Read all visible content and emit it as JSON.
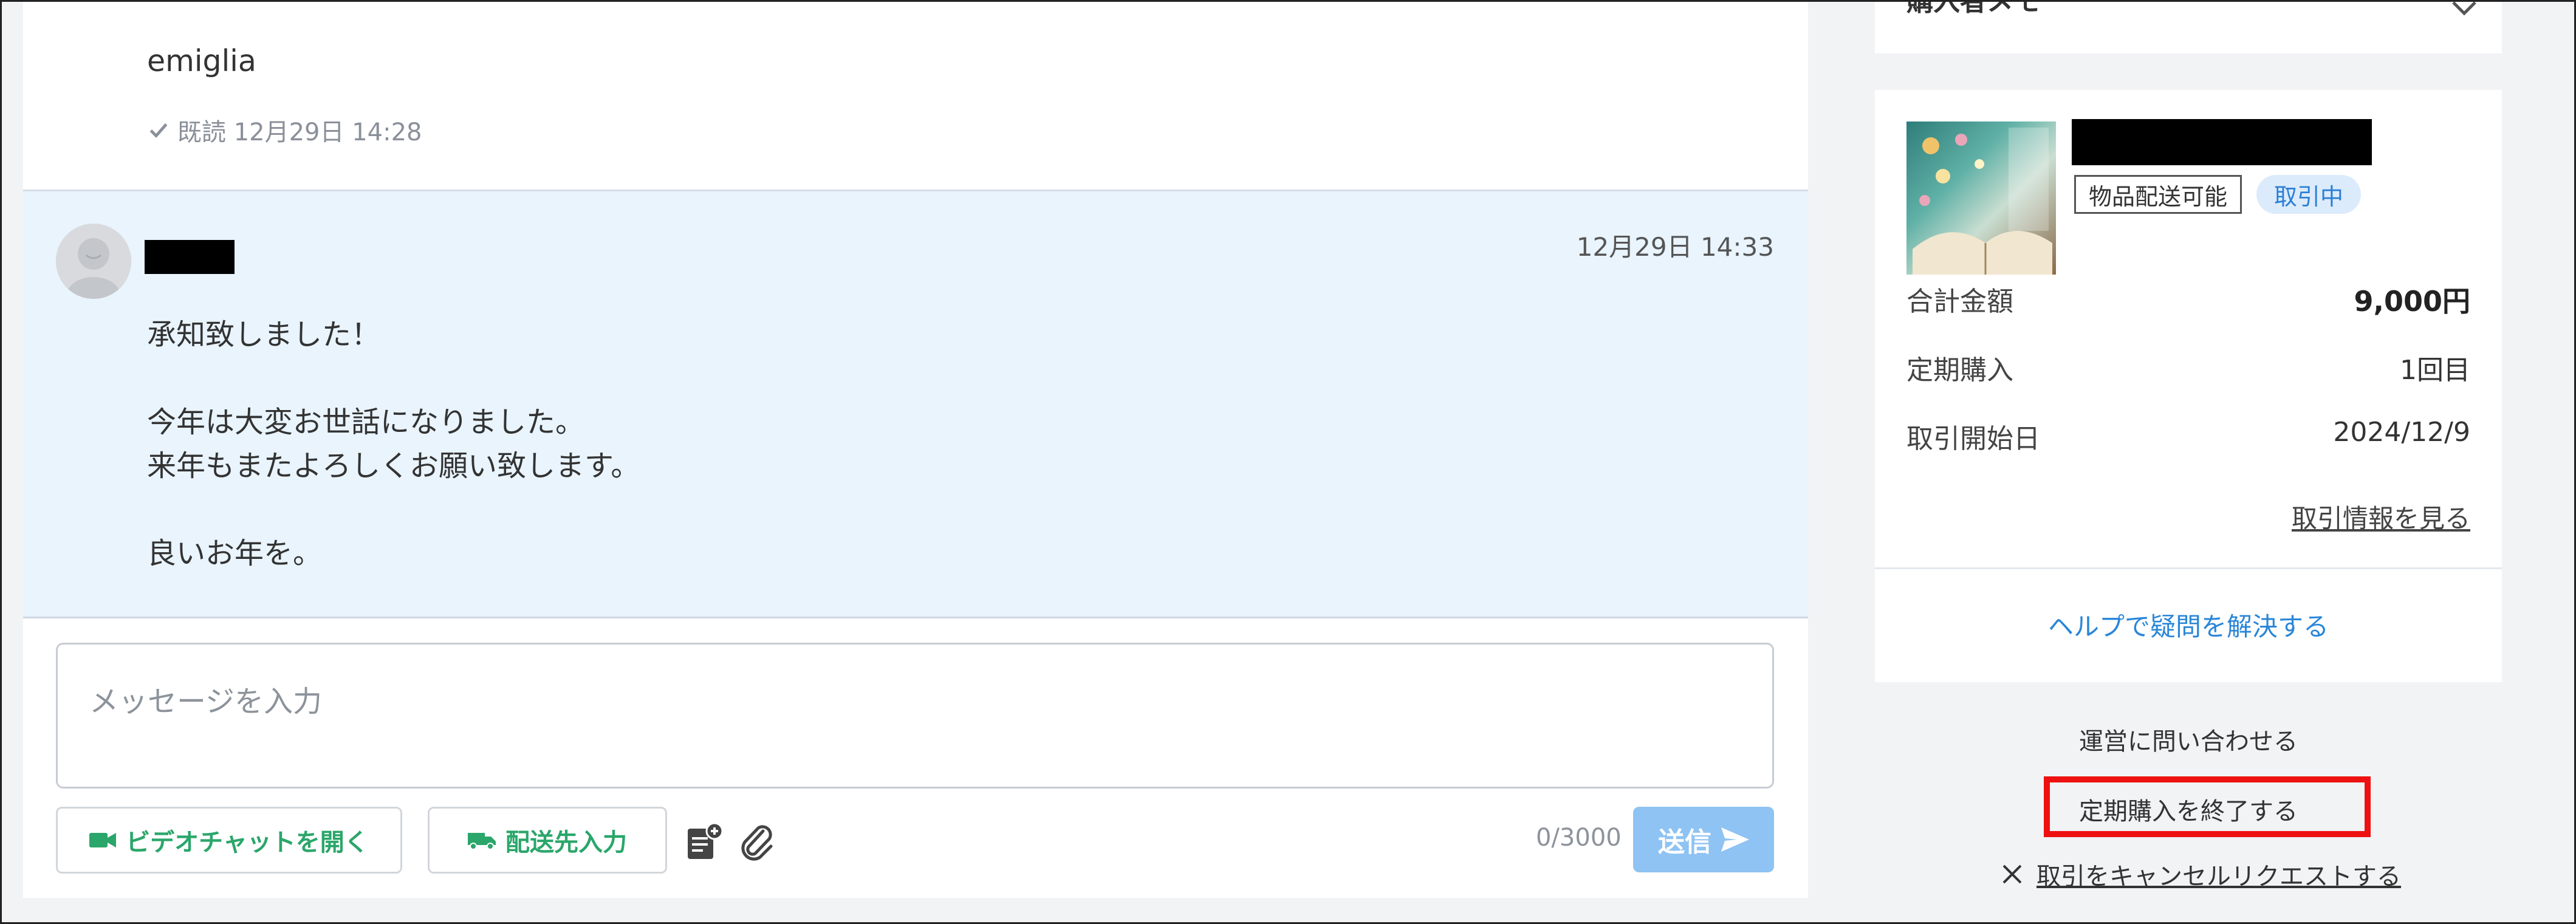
{
  "chat": {
    "previous_message": "emiglia",
    "read_status": "既読 12月29日 14:28",
    "message": {
      "time": "12月29日 14:33",
      "lines": [
        "承知致しました！",
        "",
        "今年は大変お世話になりました。",
        "来年もまたよろしくお願い致します。",
        "",
        "良いお年を。"
      ]
    },
    "composer": {
      "placeholder": "メッセージを入力",
      "video_button": "ビデオチャットを開く",
      "shipping_button": "配送先入力",
      "counter": "0/3000",
      "send_button": "送信"
    }
  },
  "sidebar": {
    "top_card_label": "購入者メモ",
    "order": {
      "tags": {
        "shipping": "物品配送可能",
        "status": "取引中"
      },
      "rows": [
        {
          "label": "合計金額",
          "value": "9,000円"
        },
        {
          "label": "定期購入",
          "value": "1回目"
        },
        {
          "label": "取引開始日",
          "value": "2024/12/9"
        }
      ],
      "info_link": "取引情報を見る",
      "help_link": "ヘルプで疑問を解決する"
    },
    "contact_link": "運営に問い合わせる",
    "end_subscription": "定期購入を終了する",
    "cancel_request": "取引をキャンセルリクエストする"
  },
  "colors": {
    "accent_green": "#2aa66a",
    "link_blue": "#2a86d8",
    "send_disabled": "#8ec3f3",
    "highlight_red": "#ee1111"
  }
}
